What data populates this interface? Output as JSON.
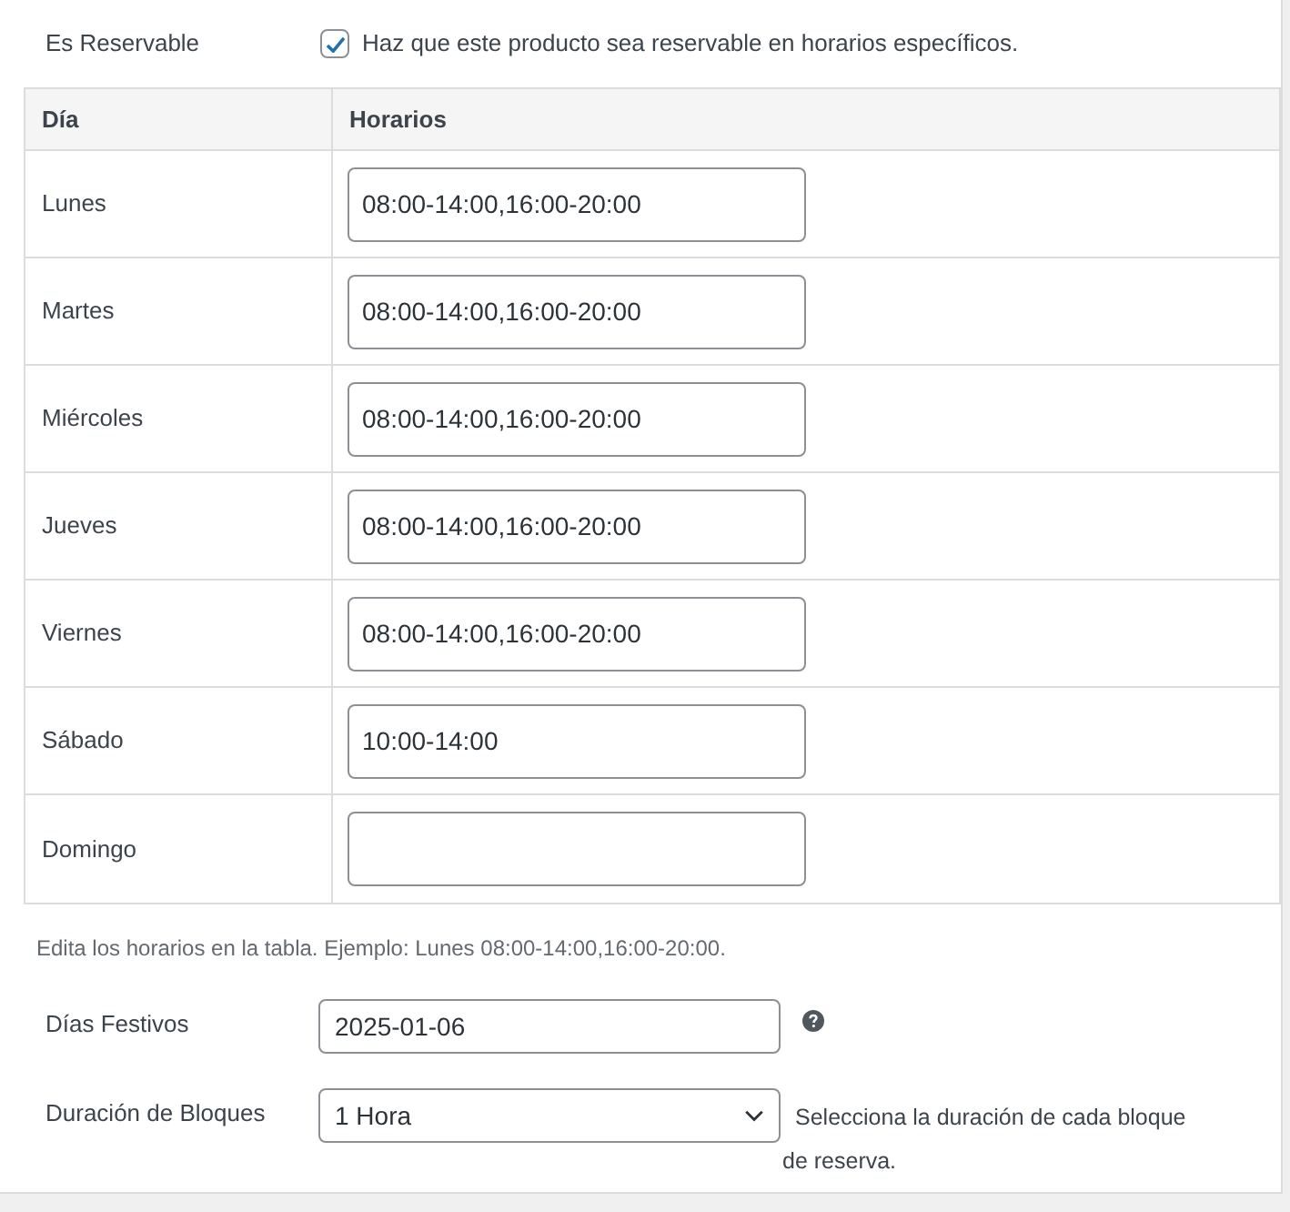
{
  "reservable": {
    "label": "Es Reservable",
    "checked": true,
    "description": "Haz que este producto sea reservable en horarios específicos."
  },
  "schedule_table": {
    "columns": [
      "Día",
      "Horarios"
    ],
    "rows": [
      {
        "day": "Lunes",
        "value": "08:00-14:00,16:00-20:00"
      },
      {
        "day": "Martes",
        "value": "08:00-14:00,16:00-20:00"
      },
      {
        "day": "Miércoles",
        "value": "08:00-14:00,16:00-20:00"
      },
      {
        "day": "Jueves",
        "value": "08:00-14:00,16:00-20:00"
      },
      {
        "day": "Viernes",
        "value": "08:00-14:00,16:00-20:00"
      },
      {
        "day": "Sábado",
        "value": "10:00-14:00"
      },
      {
        "day": "Domingo"
      }
    ]
  },
  "table_hint": "Edita los horarios en la tabla. Ejemplo: Lunes 08:00-14:00,16:00-20:00.",
  "holidays": {
    "label": "Días Festivos",
    "value": "2025-01-06"
  },
  "block_duration": {
    "label": "Duración de Bloques",
    "value": "1 Hora",
    "description": "Selecciona la duración de cada bloque de reserva."
  }
}
